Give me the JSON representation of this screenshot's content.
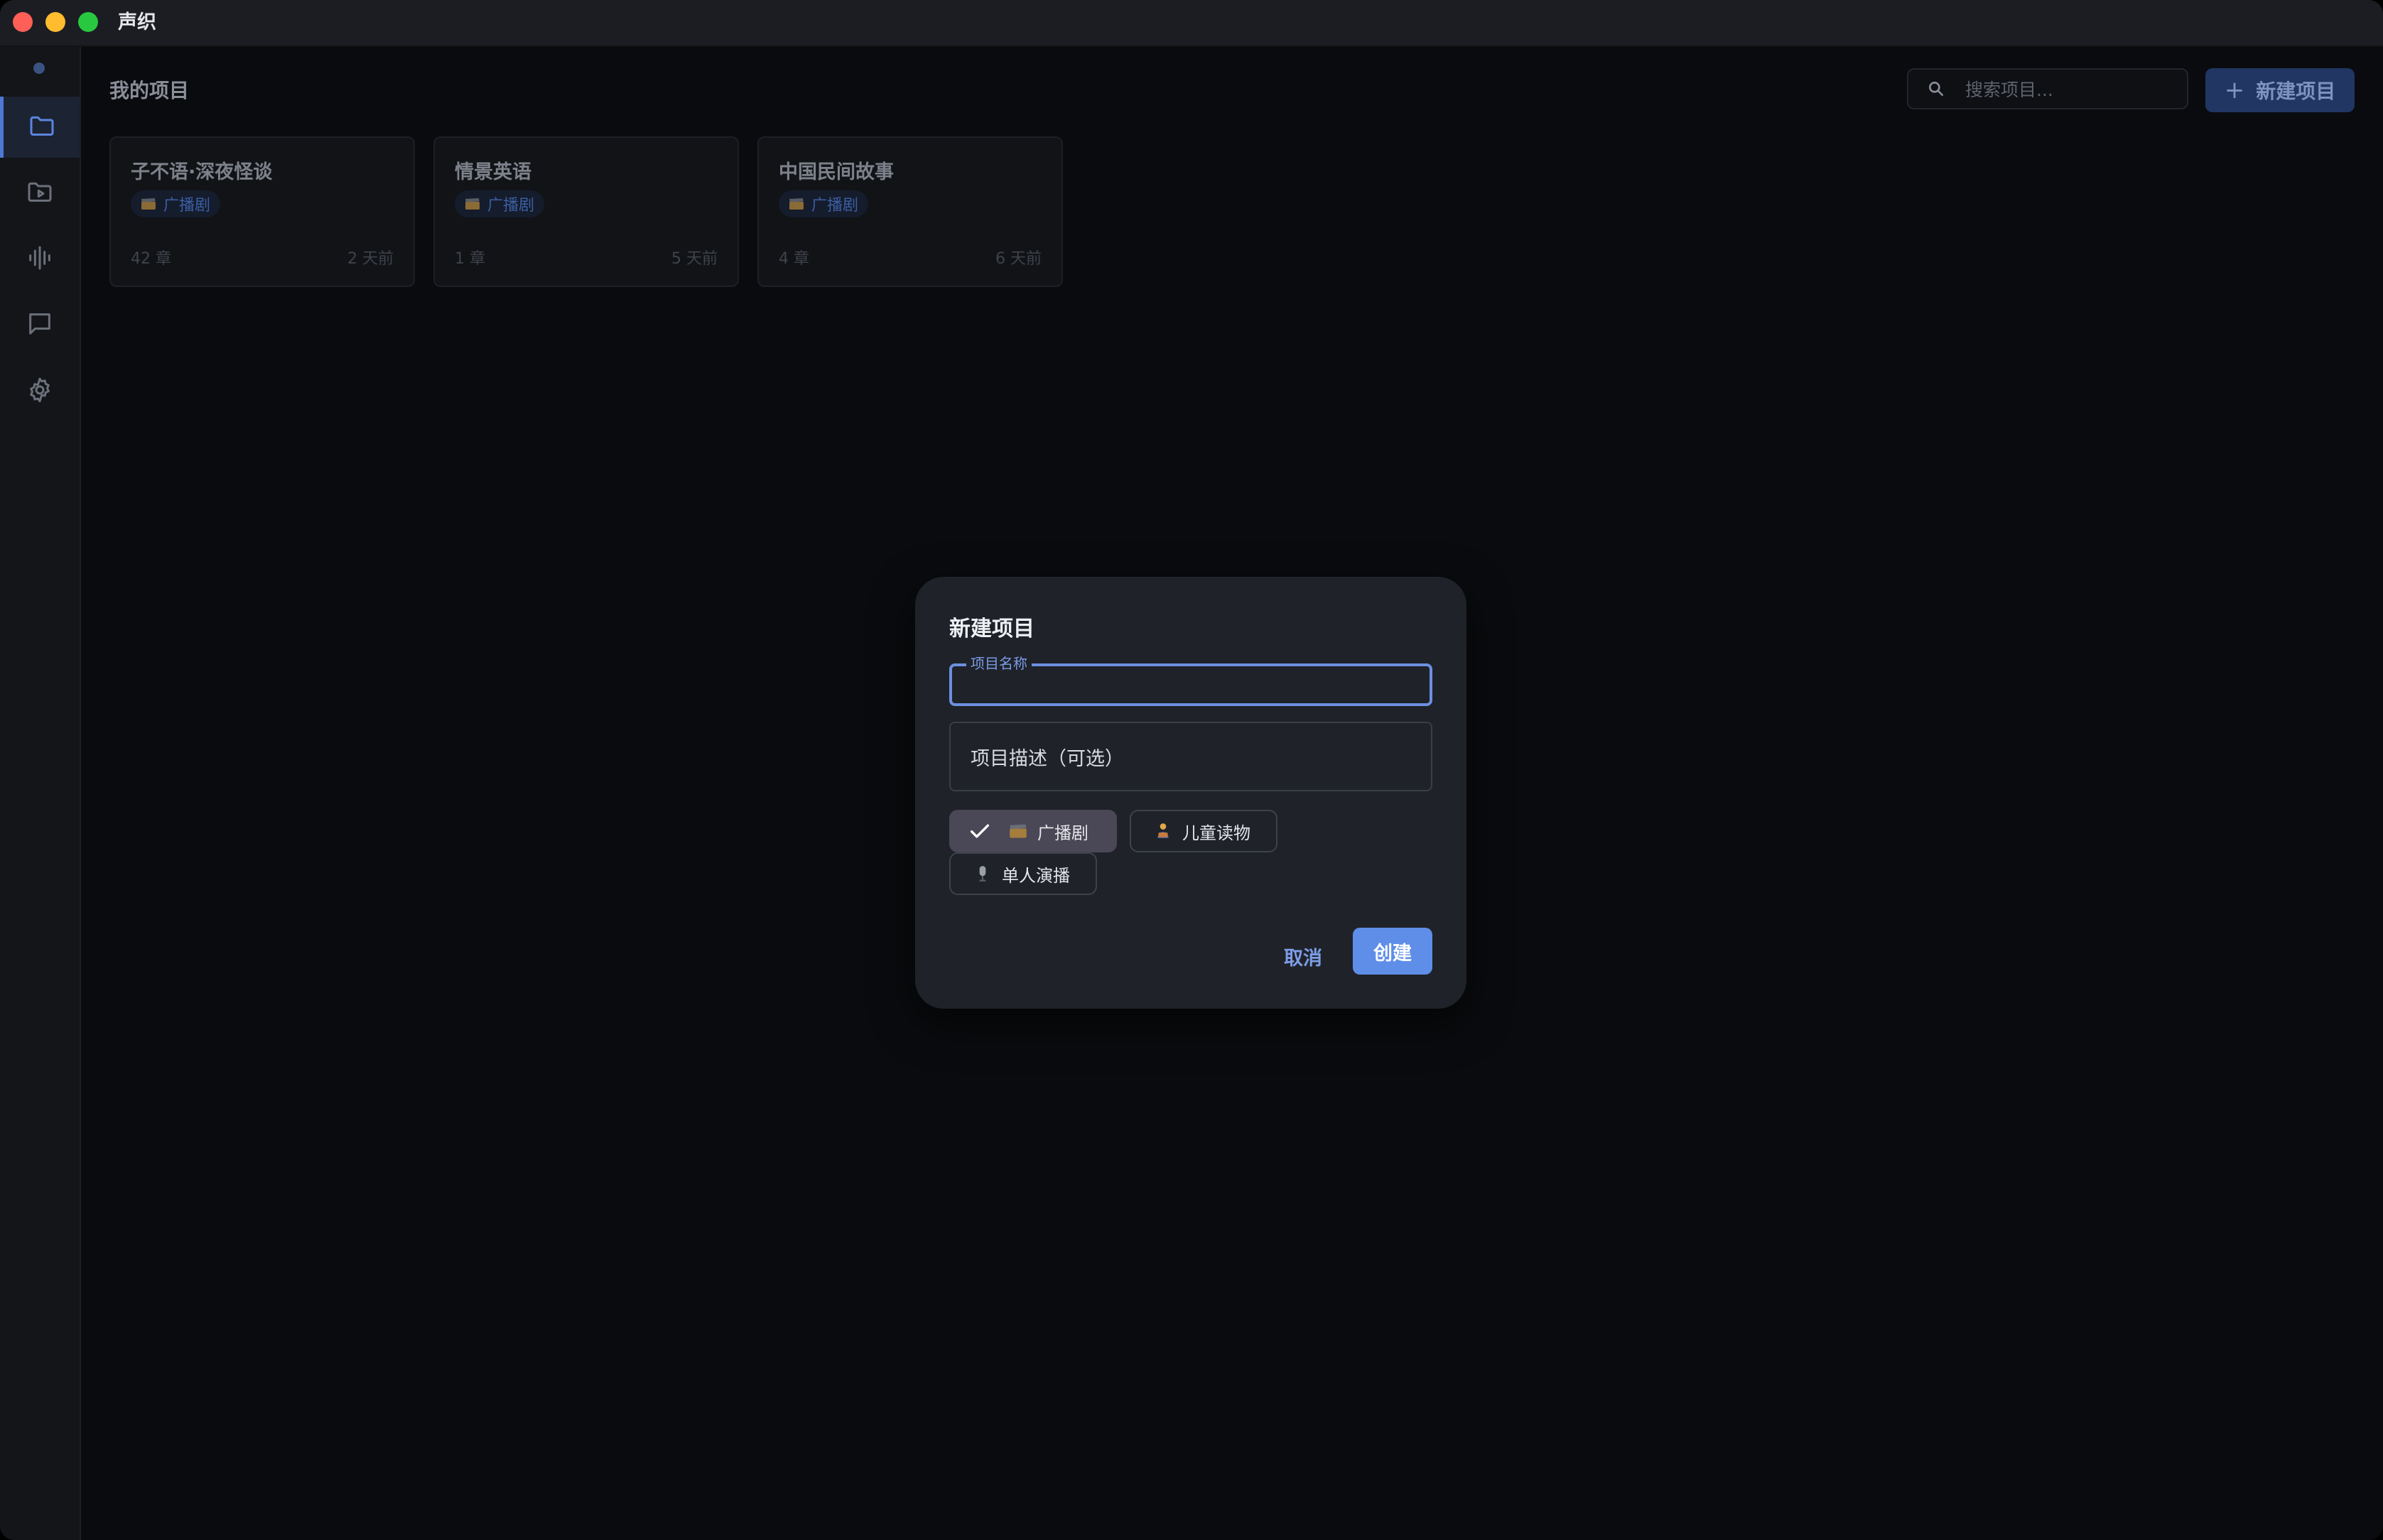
{
  "app": {
    "title": "声织"
  },
  "sidebar": {
    "items": [
      {
        "icon": "folder-icon",
        "active": true
      },
      {
        "icon": "folder-media-icon",
        "active": false
      },
      {
        "icon": "waveform-icon",
        "active": false
      },
      {
        "icon": "chat-icon",
        "active": false
      },
      {
        "icon": "gear-icon",
        "active": false
      }
    ]
  },
  "header": {
    "title": "我的项目",
    "search_placeholder": "搜索项目...",
    "new_button_label": "新建项目"
  },
  "projects": [
    {
      "title": "子不语·深夜怪谈",
      "tag": "广播剧",
      "chapters": "42 章",
      "updated": "2 天前"
    },
    {
      "title": "情景英语",
      "tag": "广播剧",
      "chapters": "1 章",
      "updated": "5 天前"
    },
    {
      "title": "中国民间故事",
      "tag": "广播剧",
      "chapters": "4 章",
      "updated": "6 天前"
    }
  ],
  "dialog": {
    "title": "新建项目",
    "name_label": "项目名称",
    "name_value": "",
    "description_placeholder": "项目描述（可选）",
    "types": [
      {
        "label": "广播剧",
        "icon": "clapperboard-icon",
        "selected": true
      },
      {
        "label": "儿童读物",
        "icon": "child-reading-icon",
        "selected": false
      },
      {
        "label": "单人演播",
        "icon": "microphone-icon",
        "selected": false
      }
    ],
    "cancel_label": "取消",
    "create_label": "创建"
  },
  "colors": {
    "accent": "#5e8ee8",
    "background": "#0a0b0e",
    "dialog": "#1f2229"
  }
}
